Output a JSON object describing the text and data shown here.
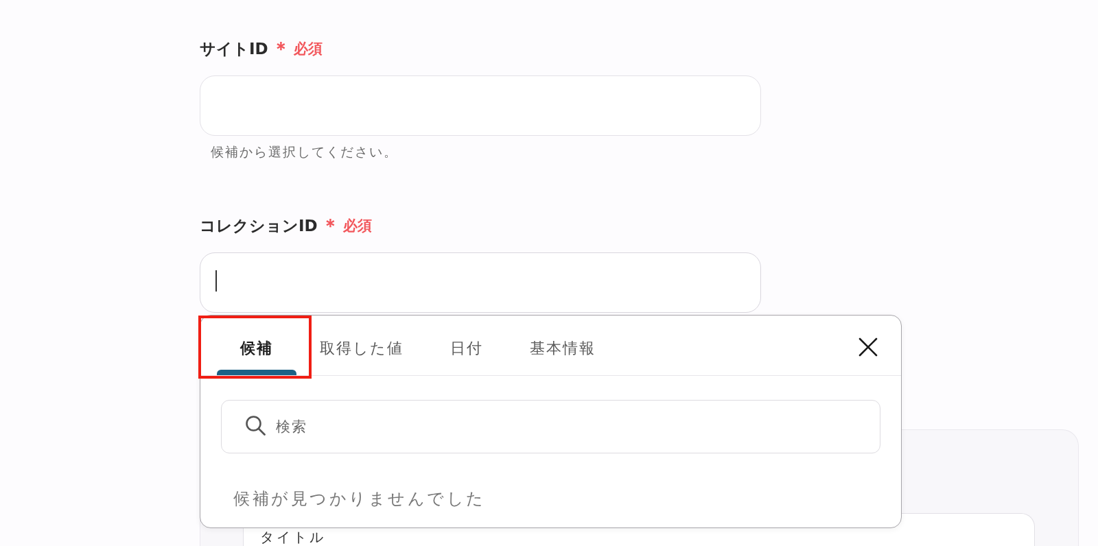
{
  "fields": [
    {
      "label": "サイトID",
      "required_mark": "＊",
      "required_text": "必須",
      "focused": false,
      "hint": "候補から選択してください。"
    },
    {
      "label": "コレクションID",
      "required_mark": "＊",
      "required_text": "必須",
      "focused": true
    }
  ],
  "popup": {
    "tabs": [
      {
        "label": "候補",
        "selected": true,
        "highlighted": true
      },
      {
        "label": "取得した値",
        "selected": false,
        "highlighted": false
      },
      {
        "label": "日付",
        "selected": false,
        "highlighted": false
      },
      {
        "label": "基本情報",
        "selected": false,
        "highlighted": false
      }
    ],
    "search": {
      "placeholder": "検索"
    },
    "empty_message": "候補が見つかりませんでした"
  },
  "section_card": {
    "field_label": "タイトル"
  }
}
